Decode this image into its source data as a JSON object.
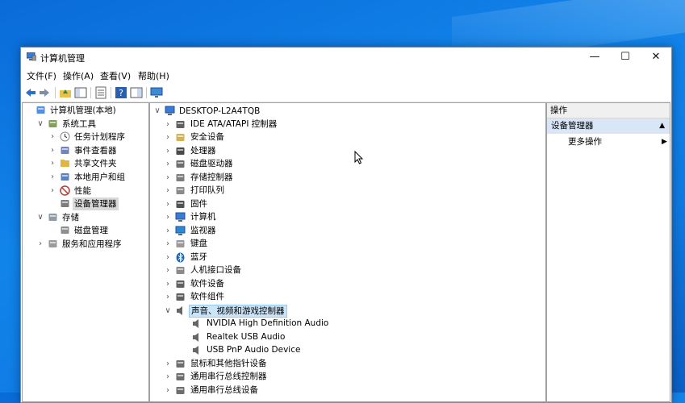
{
  "window": {
    "title": "计算机管理",
    "controls": {
      "minimize": "—",
      "maximize": "☐",
      "close": "✕"
    }
  },
  "menu": [
    "文件(F)",
    "操作(A)",
    "查看(V)",
    "帮助(H)"
  ],
  "left_tree": [
    {
      "label": "计算机管理(本地)",
      "indent": 0,
      "chev": "",
      "icon": "computer-management-icon"
    },
    {
      "label": "系统工具",
      "indent": 1,
      "chev": "∨",
      "icon": "system-tools-icon"
    },
    {
      "label": "任务计划程序",
      "indent": 2,
      "chev": "›",
      "icon": "clock-icon"
    },
    {
      "label": "事件查看器",
      "indent": 2,
      "chev": "›",
      "icon": "event-viewer-icon"
    },
    {
      "label": "共享文件夹",
      "indent": 2,
      "chev": "›",
      "icon": "shared-folder-icon"
    },
    {
      "label": "本地用户和组",
      "indent": 2,
      "chev": "›",
      "icon": "users-icon"
    },
    {
      "label": "性能",
      "indent": 2,
      "chev": "›",
      "icon": "performance-icon"
    },
    {
      "label": "设备管理器",
      "indent": 2,
      "chev": "",
      "icon": "device-manager-icon",
      "selected": true
    },
    {
      "label": "存储",
      "indent": 1,
      "chev": "∨",
      "icon": "storage-icon"
    },
    {
      "label": "磁盘管理",
      "indent": 2,
      "chev": "",
      "icon": "disk-management-icon"
    },
    {
      "label": "服务和应用程序",
      "indent": 1,
      "chev": "›",
      "icon": "services-icon"
    }
  ],
  "device_tree": {
    "root": "DESKTOP-L2A4TQB",
    "items": [
      {
        "label": "IDE ATA/ATAPI 控制器",
        "chev": "›",
        "icon": "ide-controller-icon",
        "level": 1
      },
      {
        "label": "安全设备",
        "chev": "›",
        "icon": "security-device-icon",
        "level": 1
      },
      {
        "label": "处理器",
        "chev": "›",
        "icon": "processor-icon",
        "level": 1
      },
      {
        "label": "磁盘驱动器",
        "chev": "›",
        "icon": "disk-drive-icon",
        "level": 1
      },
      {
        "label": "存储控制器",
        "chev": "›",
        "icon": "storage-controller-icon",
        "level": 1
      },
      {
        "label": "打印队列",
        "chev": "›",
        "icon": "printer-icon",
        "level": 1
      },
      {
        "label": "固件",
        "chev": "›",
        "icon": "firmware-icon",
        "level": 1
      },
      {
        "label": "计算机",
        "chev": "›",
        "icon": "computer-icon",
        "level": 1
      },
      {
        "label": "监视器",
        "chev": "›",
        "icon": "monitor-icon",
        "level": 1
      },
      {
        "label": "键盘",
        "chev": "›",
        "icon": "keyboard-icon",
        "level": 1
      },
      {
        "label": "蓝牙",
        "chev": "›",
        "icon": "bluetooth-icon",
        "level": 1
      },
      {
        "label": "人机接口设备",
        "chev": "›",
        "icon": "hid-icon",
        "level": 1
      },
      {
        "label": "软件设备",
        "chev": "›",
        "icon": "software-device-icon",
        "level": 1
      },
      {
        "label": "软件组件",
        "chev": "›",
        "icon": "software-component-icon",
        "level": 1
      },
      {
        "label": "声音、视频和游戏控制器",
        "chev": "∨",
        "icon": "speaker-icon",
        "level": 1,
        "selected": true
      },
      {
        "label": "NVIDIA High Definition Audio",
        "chev": "",
        "icon": "speaker-icon",
        "level": 2
      },
      {
        "label": "Realtek USB Audio",
        "chev": "",
        "icon": "speaker-icon",
        "level": 2
      },
      {
        "label": "USB PnP Audio Device",
        "chev": "",
        "icon": "speaker-icon",
        "level": 2
      },
      {
        "label": "鼠标和其他指针设备",
        "chev": "›",
        "icon": "mouse-icon",
        "level": 1
      },
      {
        "label": "通用串行总线控制器",
        "chev": "›",
        "icon": "usb-icon",
        "level": 1
      },
      {
        "label": "通用串行总线设备",
        "chev": "›",
        "icon": "usb-icon",
        "level": 1
      }
    ]
  },
  "actions": {
    "header": "操作",
    "section": "设备管理器",
    "more": "更多操作"
  }
}
